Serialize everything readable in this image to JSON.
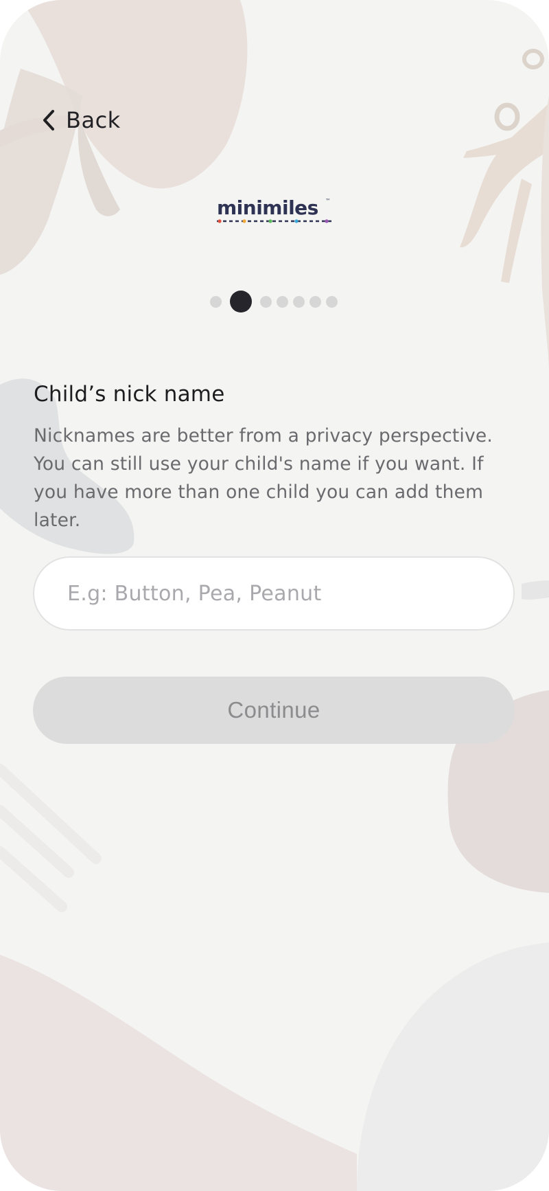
{
  "header": {
    "back_label": "Back",
    "back_icon": "chevron-left-icon"
  },
  "logo": {
    "text": "minimiles",
    "trademark": "™",
    "brand_color": "#2e3354"
  },
  "progress": {
    "total_steps": 7,
    "current_step": 2
  },
  "form": {
    "title": "Child’s nick name",
    "description": "Nicknames are better from a privacy perspective. You can still use your child's name if you want. If you have more than one child you can add them later.",
    "nickname_value": "",
    "nickname_placeholder": "E.g: Button, Pea, Peanut",
    "continue_label": "Continue",
    "continue_enabled": false
  },
  "colors": {
    "background": "#f4f4f2",
    "active_dot": "#25252b",
    "inactive_dot": "#d6d6d6",
    "disabled_button": "#dcdcdc"
  }
}
